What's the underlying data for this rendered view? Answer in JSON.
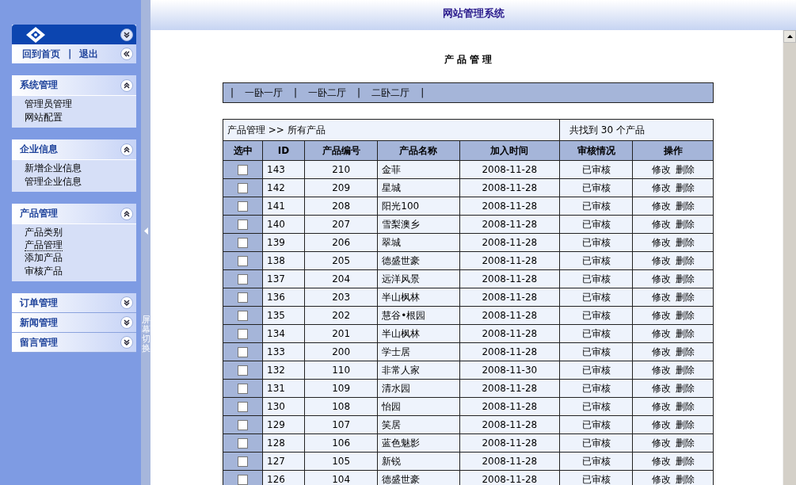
{
  "header": {
    "title": "网站管理系统"
  },
  "sidebar": {
    "top_links": [
      {
        "kind": "link",
        "text": "回到首页"
      },
      {
        "kind": "separator",
        "text": "|"
      },
      {
        "kind": "link",
        "text": "退出"
      }
    ],
    "sections": [
      {
        "title": "系统管理",
        "expanded": true,
        "items": [
          {
            "label": "管理员管理",
            "selected": false
          },
          {
            "label": "网站配置",
            "selected": false
          }
        ]
      },
      {
        "title": "企业信息",
        "expanded": true,
        "items": [
          {
            "label": "新增企业信息",
            "selected": false
          },
          {
            "label": "管理企业信息",
            "selected": false
          }
        ]
      },
      {
        "title": "产品管理",
        "expanded": true,
        "items": [
          {
            "label": "产品类别",
            "selected": false
          },
          {
            "label": "产品管理",
            "selected": true
          },
          {
            "label": "添加产品",
            "selected": false
          },
          {
            "label": "审核产品",
            "selected": false
          }
        ]
      },
      {
        "title": "订单管理",
        "expanded": false
      },
      {
        "title": "新闻管理",
        "expanded": false
      },
      {
        "title": "留言管理",
        "expanded": false
      }
    ]
  },
  "splitter": {
    "label": "屏幕切换"
  },
  "page": {
    "title": "产 品 管 理",
    "category_bar": [
      {
        "kind": "separator",
        "text": "|"
      },
      {
        "kind": "link",
        "text": "一卧一厅"
      },
      {
        "kind": "separator",
        "text": "|"
      },
      {
        "kind": "link",
        "text": "一卧二厅"
      },
      {
        "kind": "separator",
        "text": "|"
      },
      {
        "kind": "link",
        "text": "二卧二厅"
      },
      {
        "kind": "separator",
        "text": "|"
      }
    ],
    "breadcrumb": "产品管理 >> 所有产品",
    "count": "共找到 30 个产品",
    "columns": [
      "选中",
      "ID",
      "产品编号",
      "产品名称",
      "加入时间",
      "审核情况",
      "操作"
    ],
    "rows": [
      {
        "checked": false,
        "id": "143",
        "code": "210",
        "name": "金菲",
        "date": "2008-11-28",
        "status": "已审核",
        "actions": [
          "修改",
          "删除"
        ]
      },
      {
        "checked": false,
        "id": "142",
        "code": "209",
        "name": "星城",
        "date": "2008-11-28",
        "status": "已审核",
        "actions": [
          "修改",
          "删除"
        ]
      },
      {
        "checked": false,
        "id": "141",
        "code": "208",
        "name": "阳光100",
        "date": "2008-11-28",
        "status": "已审核",
        "actions": [
          "修改",
          "删除"
        ]
      },
      {
        "checked": false,
        "id": "140",
        "code": "207",
        "name": "雪梨澳乡",
        "date": "2008-11-28",
        "status": "已审核",
        "actions": [
          "修改",
          "删除"
        ]
      },
      {
        "checked": false,
        "id": "139",
        "code": "206",
        "name": "翠城",
        "date": "2008-11-28",
        "status": "已审核",
        "actions": [
          "修改",
          "删除"
        ]
      },
      {
        "checked": false,
        "id": "138",
        "code": "205",
        "name": "德盛世豪",
        "date": "2008-11-28",
        "status": "已审核",
        "actions": [
          "修改",
          "删除"
        ]
      },
      {
        "checked": false,
        "id": "137",
        "code": "204",
        "name": "远洋风景",
        "date": "2008-11-28",
        "status": "已审核",
        "actions": [
          "修改",
          "删除"
        ]
      },
      {
        "checked": false,
        "id": "136",
        "code": "203",
        "name": "半山枫林",
        "date": "2008-11-28",
        "status": "已审核",
        "actions": [
          "修改",
          "删除"
        ]
      },
      {
        "checked": false,
        "id": "135",
        "code": "202",
        "name": "慧谷•根园",
        "date": "2008-11-28",
        "status": "已审核",
        "actions": [
          "修改",
          "删除"
        ]
      },
      {
        "checked": false,
        "id": "134",
        "code": "201",
        "name": "半山枫林",
        "date": "2008-11-28",
        "status": "已审核",
        "actions": [
          "修改",
          "删除"
        ]
      },
      {
        "checked": false,
        "id": "133",
        "code": "200",
        "name": "学士居",
        "date": "2008-11-28",
        "status": "已审核",
        "actions": [
          "修改",
          "删除"
        ]
      },
      {
        "checked": false,
        "id": "132",
        "code": "110",
        "name": "非常人家",
        "date": "2008-11-30",
        "status": "已审核",
        "actions": [
          "修改",
          "删除"
        ]
      },
      {
        "checked": false,
        "id": "131",
        "code": "109",
        "name": "清水园",
        "date": "2008-11-28",
        "status": "已审核",
        "actions": [
          "修改",
          "删除"
        ]
      },
      {
        "checked": false,
        "id": "130",
        "code": "108",
        "name": "怡园",
        "date": "2008-11-28",
        "status": "已审核",
        "actions": [
          "修改",
          "删除"
        ]
      },
      {
        "checked": false,
        "id": "129",
        "code": "107",
        "name": "笑居",
        "date": "2008-11-28",
        "status": "已审核",
        "actions": [
          "修改",
          "删除"
        ]
      },
      {
        "checked": false,
        "id": "128",
        "code": "106",
        "name": "蓝色魅影",
        "date": "2008-11-28",
        "status": "已审核",
        "actions": [
          "修改",
          "删除"
        ]
      },
      {
        "checked": false,
        "id": "127",
        "code": "105",
        "name": "新锐",
        "date": "2008-11-28",
        "status": "已审核",
        "actions": [
          "修改",
          "删除"
        ]
      },
      {
        "checked": false,
        "id": "126",
        "code": "104",
        "name": "德盛世豪",
        "date": "2008-11-28",
        "status": "已审核",
        "actions": [
          "修改",
          "删除"
        ]
      }
    ]
  }
}
